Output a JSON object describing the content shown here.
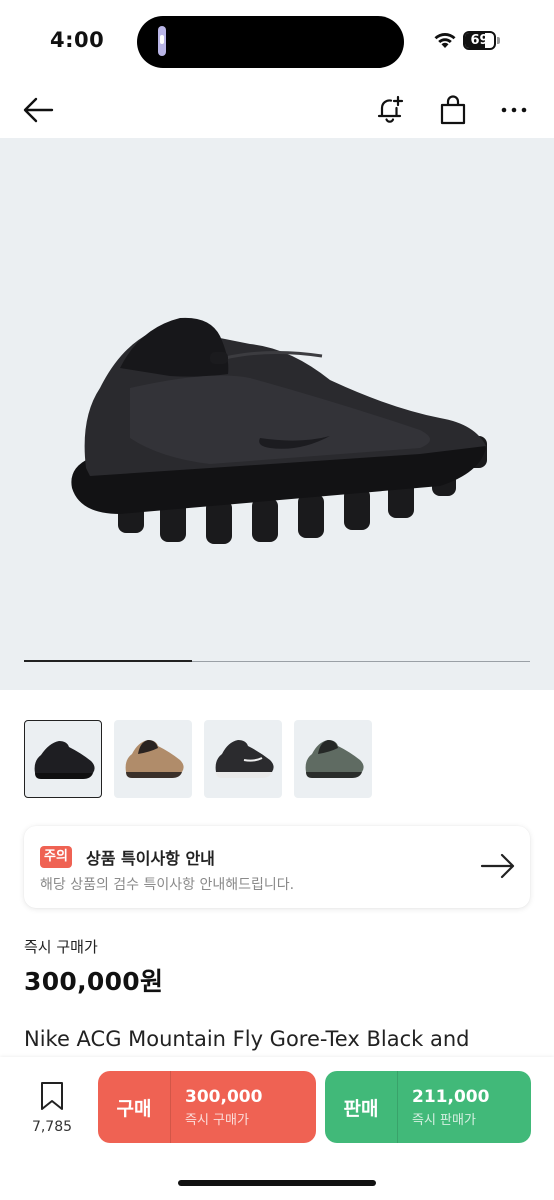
{
  "status_bar": {
    "time": "4:00",
    "battery": "69",
    "battery_level": 0.69
  },
  "nav": {
    "back_icon": "back-arrow-icon",
    "alert_icon": "bell-plus-icon",
    "cart_icon": "shopping-bag-icon",
    "more_icon": "more-icon"
  },
  "gallery": {
    "progress": 0.333,
    "thumbnails": [
      "black",
      "tan",
      "white-black",
      "olive-green"
    ]
  },
  "notice": {
    "badge": "주의",
    "title": "상품 특이사항 안내",
    "description": "해당 상품의 검수 특이사항 안내해드립니다."
  },
  "price": {
    "label": "즉시 구매가",
    "value": "300,000원"
  },
  "product": {
    "name": "Nike ACG Mountain Fly Gore-Tex Black and"
  },
  "bottom": {
    "wish_count": "7,785",
    "buy": {
      "label": "구매",
      "price": "300,000",
      "sub": "즉시 구매가"
    },
    "sell": {
      "label": "판매",
      "price": "211,000",
      "sub": "즉시 판매가"
    }
  },
  "colors": {
    "buy": "#ef6253",
    "sell": "#41b979",
    "hero_bg": "#ebeff2"
  }
}
